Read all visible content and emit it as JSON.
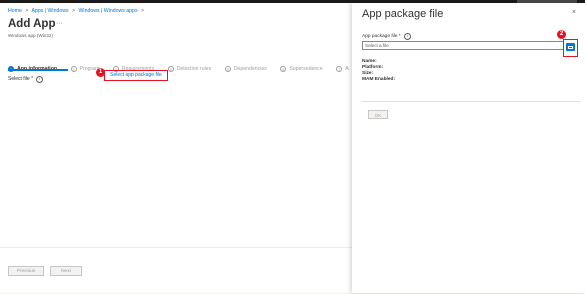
{
  "breadcrumb": [
    "Home",
    "Apps | Windows",
    "Windows | Windows apps"
  ],
  "breadcrumb_separator": ">",
  "page": {
    "title": "Add App",
    "subtitle": "Windows app (Win32)",
    "more_icon": "ellipsis-icon"
  },
  "steps": [
    {
      "num": "1",
      "label": "App information",
      "active": true
    },
    {
      "num": "2",
      "label": "Program",
      "active": false
    },
    {
      "num": "3",
      "label": "Requirements",
      "active": false
    },
    {
      "num": "4",
      "label": "Detection rules",
      "active": false
    },
    {
      "num": "5",
      "label": "Dependencies",
      "active": false
    },
    {
      "num": "6",
      "label": "Supersedence",
      "active": false
    },
    {
      "num": "7",
      "label": "A",
      "active": false
    }
  ],
  "form": {
    "select_file_label": "Select file *",
    "select_link": "Select app package file"
  },
  "callouts": {
    "one": "1",
    "two": "2"
  },
  "footer": {
    "previous": "Previous",
    "next": "Next"
  },
  "panel": {
    "title": "App package file",
    "close": "×",
    "field_label": "App package file *",
    "placeholder": "Select a file",
    "name_label": "Name:",
    "platform_label": "Platform:",
    "size_label": "Size:",
    "mam_label": "MAM Enabled:",
    "ok": "OK"
  },
  "info_glyph": "i",
  "colors": {
    "accent": "#0078d4",
    "callout": "#e81123"
  }
}
